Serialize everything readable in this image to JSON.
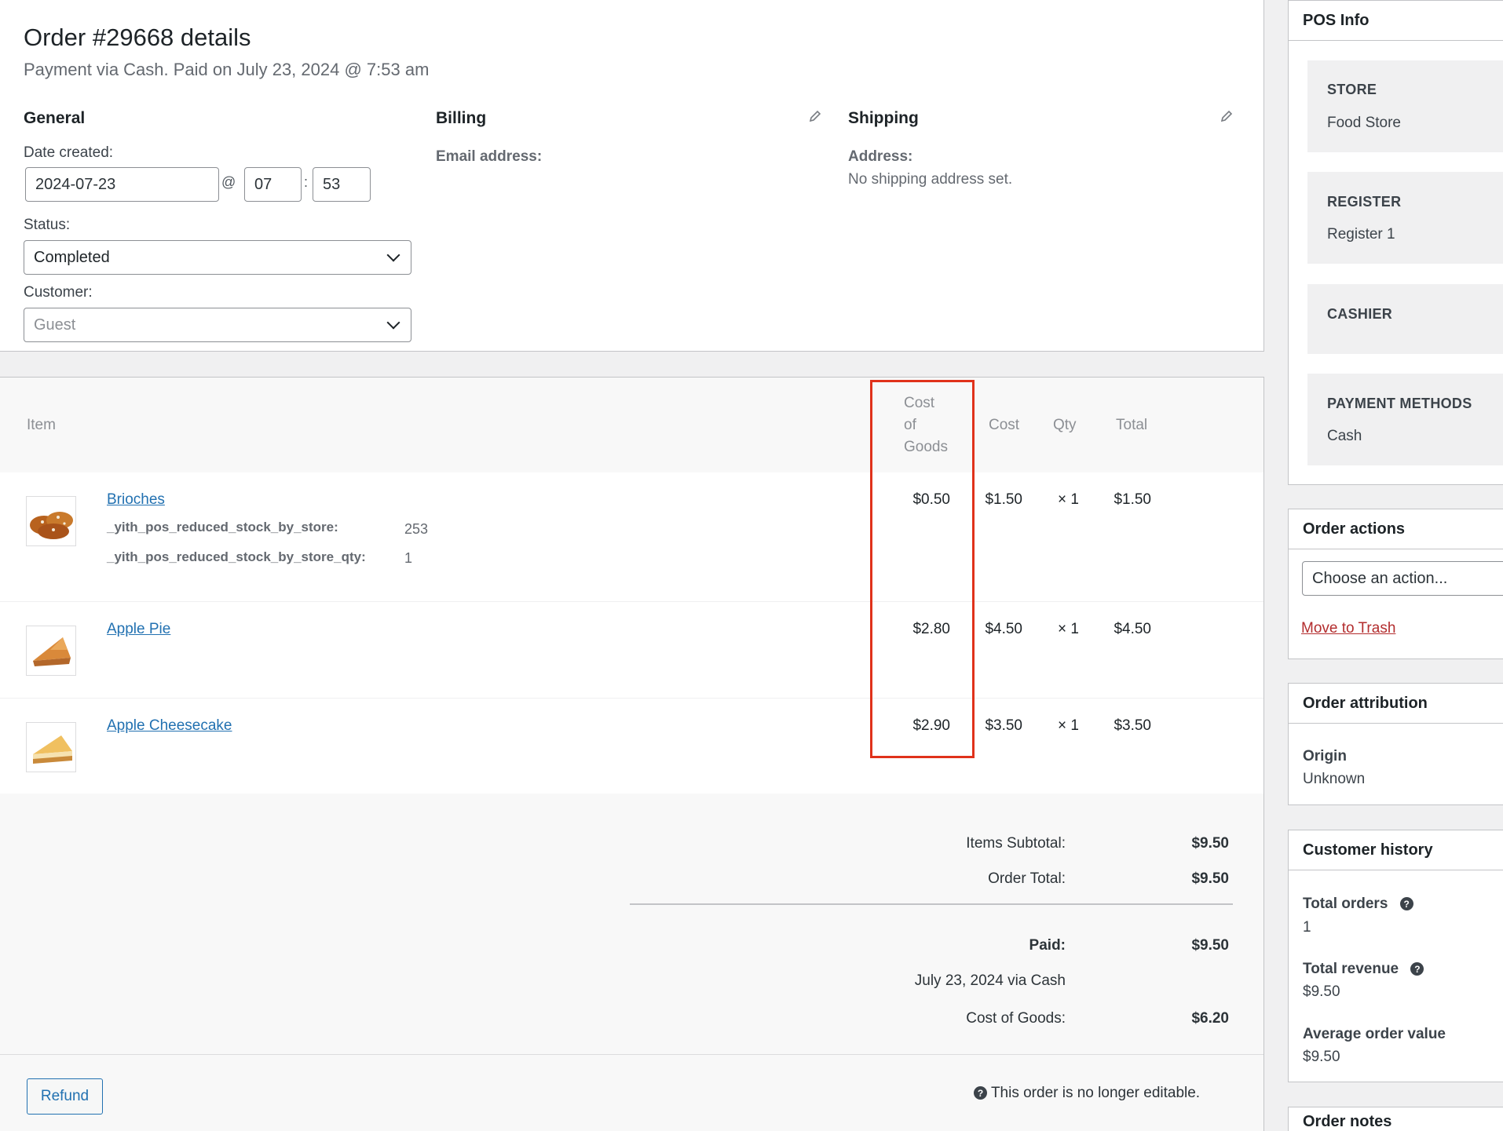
{
  "order": {
    "title": "Order #29668 details",
    "subtitle": "Payment via Cash. Paid on July 23, 2024 @ 7:53 am"
  },
  "general": {
    "heading": "General",
    "date_label": "Date created:",
    "date_value": "2024-07-23",
    "at_sep": "@",
    "hour": "07",
    "colon": ":",
    "minute": "53",
    "status_label": "Status:",
    "status_value": "Completed",
    "customer_label": "Customer:",
    "customer_value": "Guest"
  },
  "billing": {
    "heading": "Billing",
    "email_label": "Email address:"
  },
  "shipping": {
    "heading": "Shipping",
    "address_label": "Address:",
    "address_value": "No shipping address set."
  },
  "items": {
    "headers": {
      "item": "Item",
      "cog_1": "Cost",
      "cog_2": "of",
      "cog_3": "Goods",
      "cost": "Cost",
      "qty": "Qty",
      "total": "Total"
    },
    "rows": [
      {
        "name": "Brioches",
        "cog": "$0.50",
        "cost": "$1.50",
        "qty": "× 1",
        "total": "$1.50",
        "meta": [
          {
            "key": "_yith_pos_reduced_stock_by_store:",
            "value": "253"
          },
          {
            "key": "_yith_pos_reduced_stock_by_store_qty:",
            "value": "1"
          }
        ]
      },
      {
        "name": "Apple Pie",
        "cog": "$2.80",
        "cost": "$4.50",
        "qty": "× 1",
        "total": "$4.50"
      },
      {
        "name": "Apple Cheesecake",
        "cog": "$2.90",
        "cost": "$3.50",
        "qty": "× 1",
        "total": "$3.50"
      }
    ]
  },
  "totals": {
    "subtotal_label": "Items Subtotal:",
    "subtotal_value": "$9.50",
    "order_total_label": "Order Total:",
    "order_total_value": "$9.50",
    "paid_label": "Paid:",
    "paid_value": "$9.50",
    "paid_note": "July 23, 2024 via Cash",
    "cog_label": "Cost of Goods:",
    "cog_value": "$6.20"
  },
  "footer": {
    "refund_label": "Refund",
    "not_editable": "This order is no longer editable.",
    "help_glyph": "?"
  },
  "sidebar": {
    "pos_info": {
      "heading": "POS Info",
      "store_label": "STORE",
      "store_value": "Food Store",
      "register_label": "REGISTER",
      "register_value": "Register 1",
      "cashier_label": "CASHIER",
      "payment_label": "PAYMENT METHODS",
      "payment_value": "Cash"
    },
    "order_actions": {
      "heading": "Order actions",
      "select_value": "Choose an action...",
      "trash_label": "Move to Trash"
    },
    "attribution": {
      "heading": "Order attribution",
      "origin_label": "Origin",
      "origin_value": "Unknown"
    },
    "customer_history": {
      "heading": "Customer history",
      "total_orders_label": "Total orders",
      "total_orders_value": "1",
      "total_revenue_label": "Total revenue",
      "total_revenue_value": "$9.50",
      "aov_label": "Average order value",
      "aov_value": "$9.50"
    },
    "order_notes": {
      "heading": "Order notes"
    }
  },
  "colors": {
    "link": "#2271b1",
    "danger": "#b32d2e",
    "highlight_box": "#e0321b"
  }
}
